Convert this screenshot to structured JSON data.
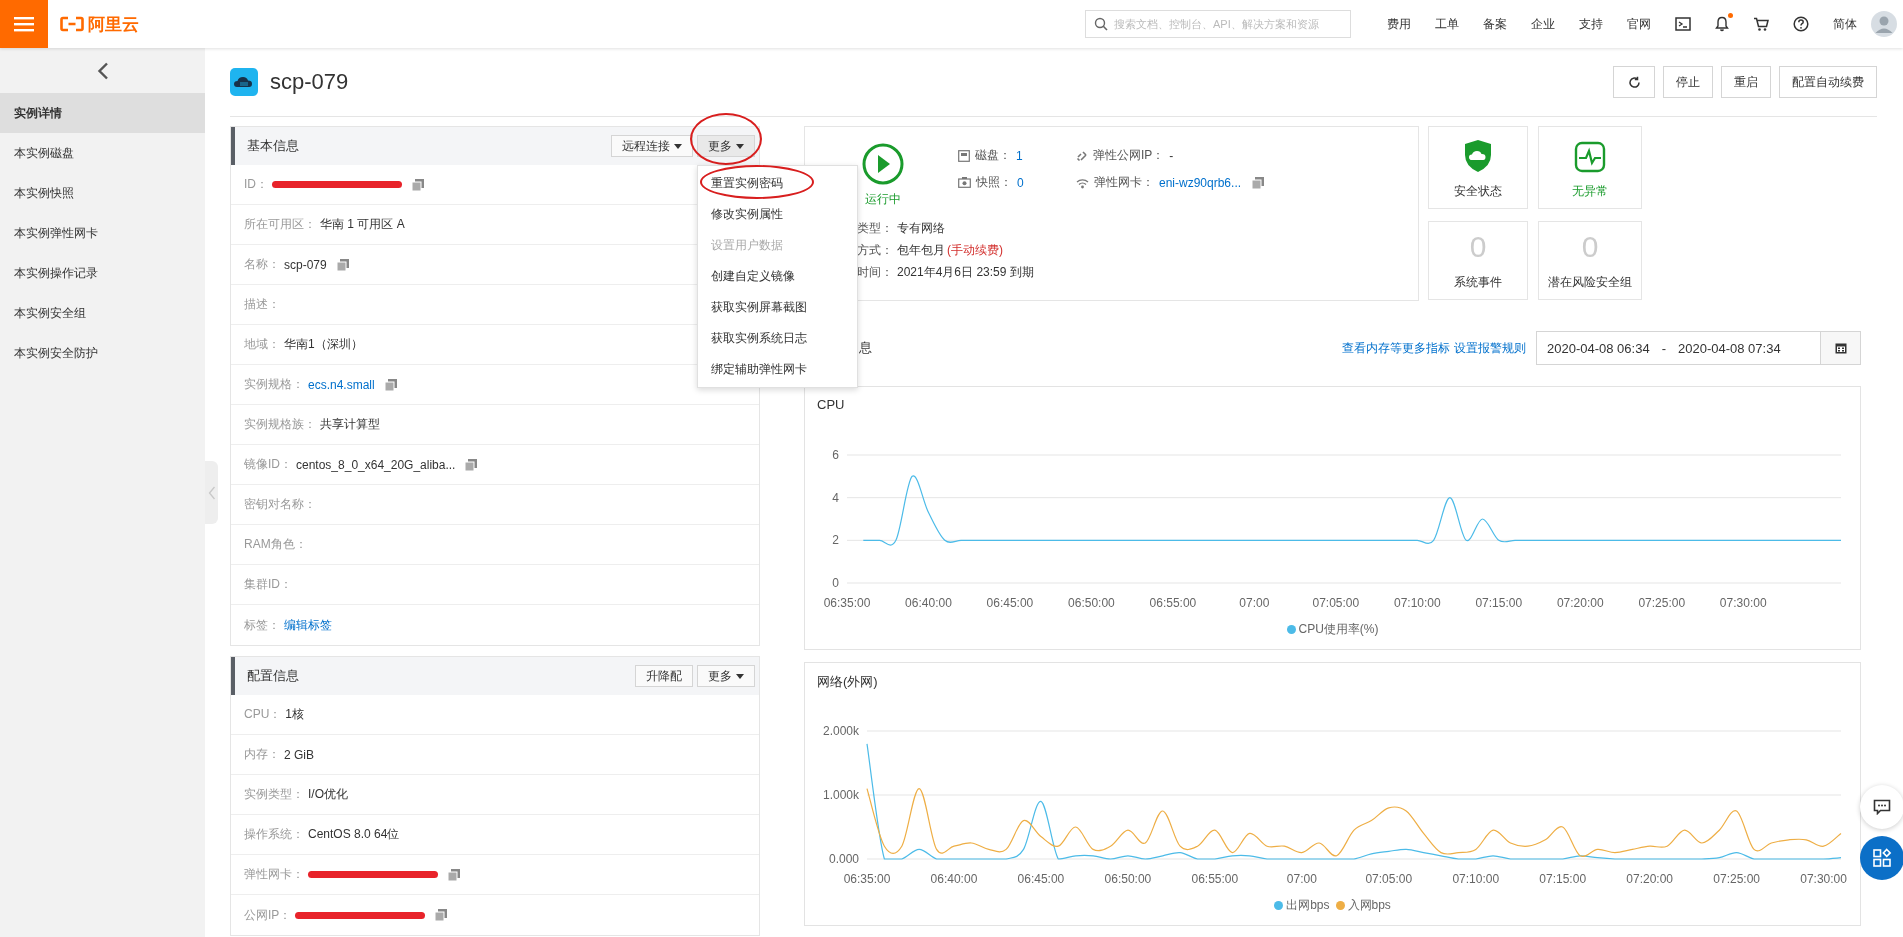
{
  "topbar": {
    "logo": "阿里云",
    "search": {
      "placeholder": "搜索文档、控制台、API、解决方案和资源"
    },
    "nav": [
      "费用",
      "工单",
      "备案",
      "企业",
      "支持",
      "官网"
    ],
    "icons": [
      {
        "kind": "terminal",
        "badge": false
      },
      {
        "kind": "bell",
        "badge": true
      },
      {
        "kind": "cart",
        "badge": false
      },
      {
        "kind": "help",
        "badge": false
      }
    ],
    "language": "简体"
  },
  "sidebar": {
    "items": [
      {
        "label": "实例详情",
        "selected": true
      },
      {
        "label": "本实例磁盘",
        "selected": false
      },
      {
        "label": "本实例快照",
        "selected": false
      },
      {
        "label": "本实例弹性网卡",
        "selected": false
      },
      {
        "label": "本实例操作记录",
        "selected": false
      },
      {
        "label": "本实例安全组",
        "selected": false
      },
      {
        "label": "本实例安全防护",
        "selected": false
      }
    ]
  },
  "page": {
    "title": "scp-079",
    "actions": [
      {
        "kind": "refresh"
      },
      {
        "kind": "text",
        "label": "停止"
      },
      {
        "kind": "text",
        "label": "重启"
      },
      {
        "kind": "text",
        "label": "配置自动续费"
      }
    ]
  },
  "basic_info": {
    "title": "基本信息",
    "buttons": [
      {
        "label": "远程连接",
        "caret": true,
        "expanded": false,
        "circled": false
      },
      {
        "label": "更多",
        "caret": true,
        "expanded": true,
        "circled": true
      }
    ],
    "menu": [
      {
        "label": "重置实例密码",
        "disabled": false,
        "circled": true
      },
      {
        "label": "修改实例属性",
        "disabled": false,
        "circled": false
      },
      {
        "label": "设置用户数据",
        "disabled": true,
        "circled": false
      },
      {
        "label": "创建自定义镜像",
        "disabled": false,
        "circled": false
      },
      {
        "label": "获取实例屏幕截图",
        "disabled": false,
        "circled": false
      },
      {
        "label": "获取实例系统日志",
        "disabled": false,
        "circled": false
      },
      {
        "label": "绑定辅助弹性网卡",
        "disabled": false,
        "circled": false
      }
    ],
    "rows": [
      {
        "label": "ID：",
        "kind": "redacted",
        "copy": true
      },
      {
        "label": "所在可用区：",
        "value": "华南 1 可用区 A",
        "kind": "plain",
        "copy": false
      },
      {
        "label": "名称：",
        "value": "scp-079",
        "kind": "plain",
        "copy": true
      },
      {
        "label": "描述：",
        "kind": "empty",
        "copy": false
      },
      {
        "label": "地域：",
        "value": "华南1（深圳）",
        "kind": "plain",
        "copy": false
      },
      {
        "label": "实例规格：",
        "value": "ecs.n4.small",
        "kind": "link",
        "copy": true
      },
      {
        "label": "实例规格族：",
        "value": "共享计算型",
        "kind": "plain",
        "copy": false
      },
      {
        "label": "镜像ID：",
        "value": "centos_8_0_x64_20G_aliba...",
        "kind": "plain",
        "copy": true
      },
      {
        "label": "密钥对名称：",
        "kind": "empty",
        "copy": false
      },
      {
        "label": "RAM角色：",
        "kind": "empty",
        "copy": false
      },
      {
        "label": "集群ID：",
        "kind": "empty",
        "copy": false
      },
      {
        "label": "标签：",
        "value": "编辑标签",
        "kind": "link",
        "copy": false
      }
    ]
  },
  "config_info": {
    "title": "配置信息",
    "buttons": [
      {
        "label": "升降配",
        "caret": false,
        "expanded": false,
        "circled": false
      },
      {
        "label": "更多",
        "caret": true,
        "expanded": false,
        "circled": false
      }
    ],
    "rows": [
      {
        "label": "CPU：",
        "value": "1核",
        "kind": "plain",
        "copy": false
      },
      {
        "label": "内存：",
        "value": "2 GiB",
        "kind": "plain",
        "copy": false
      },
      {
        "label": "实例类型：",
        "value": "I/O优化",
        "kind": "plain",
        "copy": false
      },
      {
        "label": "操作系统：",
        "value": "CentOS 8.0 64位",
        "kind": "plain",
        "copy": false
      },
      {
        "label": "弹性网卡：",
        "kind": "redacted",
        "copy": true
      },
      {
        "label": "公网IP：",
        "kind": "redacted",
        "copy": true
      }
    ]
  },
  "status": {
    "state": "运行中",
    "running": true,
    "stats": [
      {
        "kind": "disk",
        "label": "磁盘：",
        "value": "1",
        "link": true,
        "copy": false
      },
      {
        "kind": "eip",
        "label": "弹性公网IP：",
        "value": "-",
        "link": false,
        "copy": false
      },
      {
        "kind": "snapshot",
        "label": "快照：",
        "value": "0",
        "link": true,
        "copy": false
      },
      {
        "kind": "nic",
        "label": "弹性网卡：",
        "value": "eni-wz90qrb6...",
        "link": true,
        "copy": true
      }
    ],
    "lines": [
      {
        "label": "类型：",
        "value": "专有网络"
      },
      {
        "label": "方式：",
        "value": "包年包月",
        "note": "(手动续费)"
      },
      {
        "label": "时间：",
        "value": "2021年4月6日 23:59 到期"
      }
    ]
  },
  "tiles": [
    {
      "kind": "shield",
      "label": "安全状态",
      "highlighted": false
    },
    {
      "kind": "pulse",
      "label": "无异常",
      "highlighted": true
    },
    {
      "kind": "count",
      "value": "0",
      "label": "系统事件",
      "highlighted": false
    },
    {
      "kind": "count",
      "value": "0",
      "label": "潜在风险安全组",
      "highlighted": false
    }
  ],
  "monitor": {
    "title_fragment": "息",
    "links": [
      "查看内存等更多指标",
      "设置报警规则"
    ],
    "range": {
      "start": "2020-04-08 06:34",
      "separator": "-",
      "end": "2020-04-08 07:34"
    }
  },
  "charts": [
    {
      "title": "CPU",
      "chart_data": {
        "type": "line",
        "legend": "bottom",
        "ylim": [
          0,
          6
        ],
        "yticks": [
          0,
          2,
          4,
          6
        ],
        "categories": [
          "06:35:00",
          null,
          null,
          null,
          null,
          "06:40:00",
          null,
          null,
          null,
          null,
          "06:45:00",
          null,
          null,
          null,
          null,
          "06:50:00",
          null,
          null,
          null,
          null,
          "06:55:00",
          null,
          null,
          null,
          null,
          "07:00",
          null,
          null,
          null,
          null,
          "07:05:00",
          null,
          null,
          null,
          null,
          "07:10:00",
          null,
          null,
          null,
          null,
          "07:15:00",
          null,
          null,
          null,
          null,
          "07:20:00",
          null,
          null,
          null,
          null,
          "07:25:00",
          null,
          null,
          null,
          null,
          "07:30:00",
          null,
          null,
          null,
          null,
          null,
          null
        ],
        "series": [
          {
            "name": "CPU使用率(%)",
            "color": "#4cbbe8",
            "values": [
              null,
              2,
              2,
              2,
              5,
              3.3,
              2,
              2,
              2,
              2,
              2,
              2,
              2,
              2,
              2,
              2,
              2,
              2,
              2,
              2,
              2,
              2,
              2,
              2,
              2,
              2,
              2,
              2,
              2,
              2,
              2,
              2,
              2,
              2,
              2,
              2,
              2,
              4,
              2,
              3,
              2,
              2,
              2,
              2,
              2,
              2,
              2,
              2,
              2,
              2,
              2,
              2,
              2,
              2,
              2,
              2,
              2,
              2,
              2,
              2,
              2,
              2
            ]
          }
        ]
      }
    },
    {
      "title": "网络(外网)",
      "chart_data": {
        "type": "line",
        "legend": "bottom",
        "ylim": [
          0,
          2
        ],
        "yticks": [
          {
            "value": 0,
            "label": "0.000"
          },
          {
            "value": 1,
            "label": "1.000k"
          },
          {
            "value": 2,
            "label": "2.000k"
          }
        ],
        "categories": [
          "06:35:00",
          null,
          null,
          null,
          null,
          "06:40:00",
          null,
          null,
          null,
          null,
          "06:45:00",
          null,
          null,
          null,
          null,
          "06:50:00",
          null,
          null,
          null,
          null,
          "06:55:00",
          null,
          null,
          null,
          null,
          "07:00",
          null,
          null,
          null,
          null,
          "07:05:00",
          null,
          null,
          null,
          null,
          "07:10:00",
          null,
          null,
          null,
          null,
          "07:15:00",
          null,
          null,
          null,
          null,
          "07:20:00",
          null,
          null,
          null,
          null,
          "07:25:00",
          null,
          null,
          null,
          null,
          "07:30:00",
          null
        ],
        "series": [
          {
            "name": "出网bps",
            "color": "#4cbbe8",
            "values": [
              1.8,
              0,
              0,
              0.15,
              0,
              0,
              0,
              0,
              0,
              0.15,
              0.9,
              0,
              0.05,
              0.05,
              0,
              0.05,
              0,
              0.05,
              0.1,
              0,
              0,
              0.05,
              0.05,
              0,
              0,
              0,
              0,
              0,
              0,
              0.08,
              0.12,
              0.15,
              0.1,
              0.05,
              0,
              0,
              0.05,
              0,
              0,
              0,
              0,
              0.05,
              0.02,
              0,
              0,
              0,
              0,
              0,
              0,
              0.02,
              0.1,
              0,
              0,
              0,
              0,
              0,
              0.02
            ]
          },
          {
            "name": "入网bps",
            "color": "#eeae45",
            "values": [
              1.1,
              0.2,
              0.2,
              1.1,
              0.15,
              0.2,
              0.25,
              0.15,
              0.15,
              0.6,
              0.35,
              0.2,
              0.5,
              0.15,
              0.2,
              0.45,
              0.25,
              0.75,
              0.2,
              0.2,
              0.45,
              0.1,
              0.4,
              0.2,
              0.2,
              0.1,
              0.25,
              0.05,
              0.45,
              0.6,
              0.8,
              0.75,
              0.4,
              0.1,
              0.1,
              0.15,
              0.45,
              0.25,
              0.2,
              0.3,
              0.5,
              0.05,
              0.15,
              0.1,
              0.15,
              0.2,
              0.2,
              0.45,
              0.25,
              0.45,
              0.75,
              0.15,
              0.25,
              0.3,
              0.3,
              0.2,
              0.4
            ]
          }
        ]
      }
    }
  ]
}
